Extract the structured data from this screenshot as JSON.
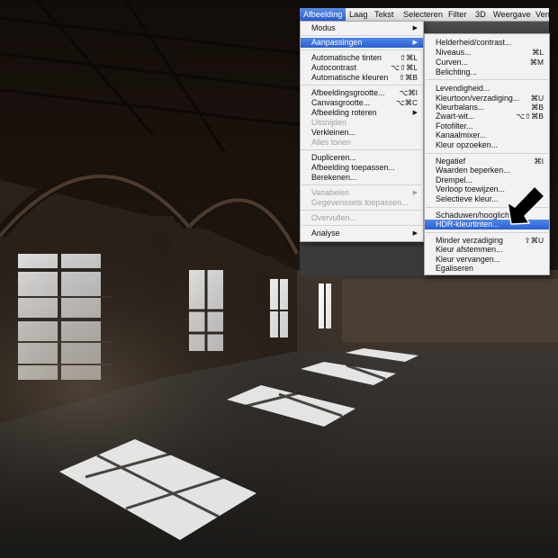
{
  "menubar": {
    "items": [
      "Afbeelding",
      "Laag",
      "Tekst",
      "Selecteren",
      "Filter",
      "3D",
      "Weergave",
      "Ven"
    ],
    "active_index": 0
  },
  "menu_main": {
    "modus": {
      "label": "Modus"
    },
    "aanpassingen": {
      "label": "Aanpassingen"
    },
    "auto_tinten": {
      "label": "Automatische tinten",
      "shortcut": "⇧⌘L"
    },
    "autocontrast": {
      "label": "Autocontrast",
      "shortcut": "⌥⇧⌘L"
    },
    "auto_kleuren": {
      "label": "Automatische kleuren",
      "shortcut": "⇧⌘B"
    },
    "afbeeldingsgrootte": {
      "label": "Afbeeldingsgrootte...",
      "shortcut": "⌥⌘I"
    },
    "canvasgrootte": {
      "label": "Canvasgrootte...",
      "shortcut": "⌥⌘C"
    },
    "roteren": {
      "label": "Afbeelding roteren"
    },
    "uitsnijden": {
      "label": "Uitsnijden"
    },
    "verkleinen": {
      "label": "Verkleinen..."
    },
    "alles_tonen": {
      "label": "Alles tonen"
    },
    "dupliceren": {
      "label": "Dupliceren..."
    },
    "toepassen": {
      "label": "Afbeelding toepassen..."
    },
    "berekenen": {
      "label": "Berekenen..."
    },
    "variabelen": {
      "label": "Variabelen"
    },
    "gegevenssets": {
      "label": "Gegevenssets toepassen..."
    },
    "overvullen": {
      "label": "Overvullen..."
    },
    "analyse": {
      "label": "Analyse"
    }
  },
  "menu_sub": {
    "helderheid": {
      "label": "Helderheid/contrast..."
    },
    "niveaus": {
      "label": "Niveaus...",
      "shortcut": "⌘L"
    },
    "curven": {
      "label": "Curven...",
      "shortcut": "⌘M"
    },
    "belichting": {
      "label": "Belichting..."
    },
    "levendigheid": {
      "label": "Levendigheid..."
    },
    "kleurtoon": {
      "label": "Kleurtoon/verzadiging...",
      "shortcut": "⌘U"
    },
    "kleurbalans": {
      "label": "Kleurbalans...",
      "shortcut": "⌘B"
    },
    "zwart_wit": {
      "label": "Zwart-wit...",
      "shortcut": "⌥⇧⌘B"
    },
    "fotofilter": {
      "label": "Fotofilter..."
    },
    "kanaalmixer": {
      "label": "Kanaalmixer..."
    },
    "kleur_opzoeken": {
      "label": "Kleur opzoeken..."
    },
    "negatief": {
      "label": "Negatief",
      "shortcut": "⌘I"
    },
    "waarden_beperken": {
      "label": "Waarden beperken..."
    },
    "drempel": {
      "label": "Drempel..."
    },
    "verloop": {
      "label": "Verloop toewijzen..."
    },
    "selectieve_kleur": {
      "label": "Selectieve kleur..."
    },
    "schaduwen": {
      "label": "Schaduwen/hooglichten..."
    },
    "hdr": {
      "label": "HDR-kleurtinten..."
    },
    "minder_verzadiging": {
      "label": "Minder verzadiging",
      "shortcut": "⇧⌘U"
    },
    "kleur_afstemmen": {
      "label": "Kleur afstemmen..."
    },
    "kleur_vervangen": {
      "label": "Kleur vervangen..."
    },
    "egaliseren": {
      "label": "Egaliseren"
    }
  },
  "colors": {
    "highlight": "#2f66d8",
    "menu_bg": "#f6f6f6",
    "disabled_text": "#a0a0a0",
    "app_dark": "#3c3c3c"
  },
  "icons": [
    "submenu-arrow-icon",
    "pointer-arrow-icon"
  ]
}
